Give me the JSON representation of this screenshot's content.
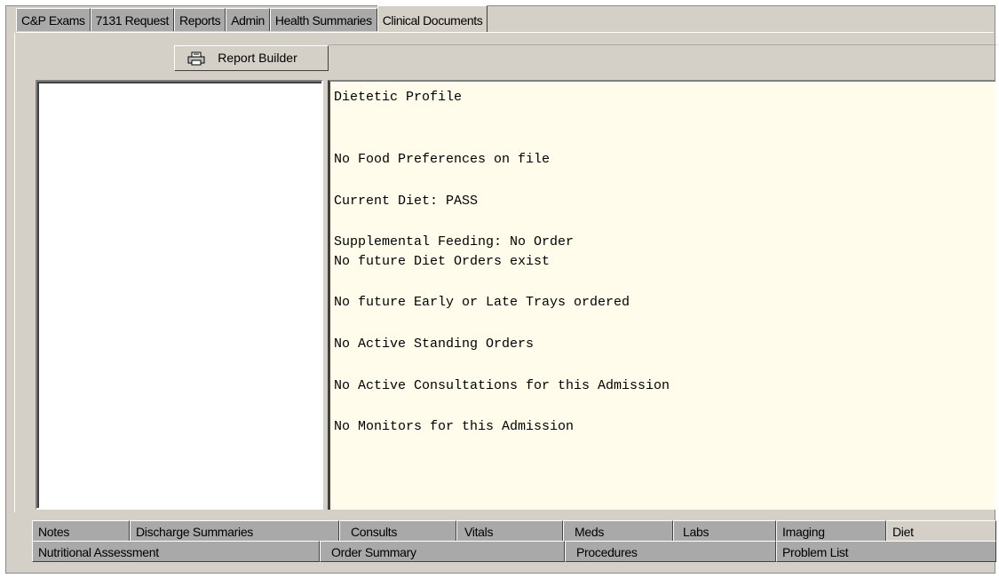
{
  "top_tabs": [
    {
      "label": "C&P Exams",
      "active": false
    },
    {
      "label": "7131 Request",
      "active": false
    },
    {
      "label": "Reports",
      "active": false
    },
    {
      "label": "Admin",
      "active": false
    },
    {
      "label": "Health Summaries",
      "active": false
    },
    {
      "label": "Clinical Documents",
      "active": true
    }
  ],
  "toolbar": {
    "report_builder_label": "Report Builder",
    "report_builder_icon": "printer-icon"
  },
  "report": {
    "lines": [
      "Dietetic Profile",
      "No Food Preferences on file",
      "Current Diet: PASS",
      "Supplemental Feeding: No Order",
      "No future Diet Orders exist",
      "No future Early or Late Trays ordered",
      "No Active Standing Orders",
      "No Active Consultations for this Admission",
      "No Monitors for this Admission"
    ]
  },
  "bottom_tabs_row1": [
    {
      "label": "Notes",
      "mnemonic": "N",
      "active": false
    },
    {
      "label": "Discharge Summaries",
      "mnemonic": "D",
      "active": false
    },
    {
      "label": "Consults",
      "mnemonic": "n",
      "active": false
    },
    {
      "label": "Vitals",
      "mnemonic": "V",
      "active": false
    },
    {
      "label": "Meds",
      "mnemonic": "M",
      "active": false
    },
    {
      "label": "Labs",
      "mnemonic": "L",
      "active": false
    },
    {
      "label": "Imaging",
      "mnemonic": "I",
      "active": false
    },
    {
      "label": "Diet",
      "mnemonic": "i",
      "active": true
    }
  ],
  "bottom_tabs_row2": [
    {
      "label": "Nutritional Assessment",
      "mnemonic": "u",
      "active": false
    },
    {
      "label": "Order Summary",
      "mnemonic": "O",
      "active": false
    },
    {
      "label": "Procedures",
      "mnemonic": "P",
      "active": false
    },
    {
      "label": "Problem List",
      "mnemonic": "L",
      "active": false
    }
  ]
}
